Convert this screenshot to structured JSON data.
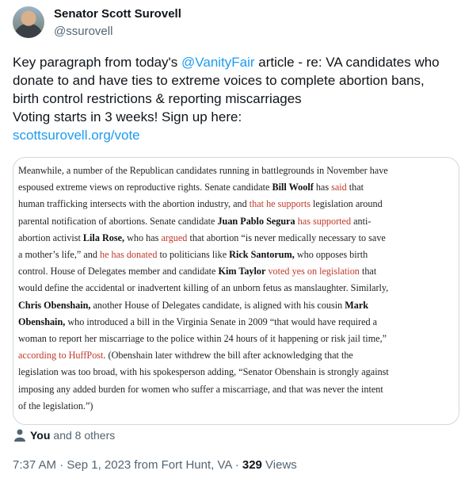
{
  "author": {
    "name": "Senator Scott Surovell",
    "handle": "@ssurovell"
  },
  "tweet": {
    "line1_a": "Key paragraph from today's ",
    "line1_mention": "@VanityFair",
    "line1_b": " article  - re: VA candidates who",
    "line2": "donate to and have ties to extreme voices to complete abortion bans,",
    "line3": "birth control restrictions & reporting miscarriages",
    "line4": "Voting starts in 3 weeks!  Sign up here:",
    "link": "scottsurovell.org/vote"
  },
  "excerpt": {
    "l1": "Meanwhile, a number of the Republican candidates running in battlegrounds in November have",
    "l2": "espoused extreme views on reproductive rights. Senate candidate ",
    "l2_b": "Bill Woolf",
    "l2_c": " has ",
    "l2_r": "said",
    "l2_d": " that",
    "l3_a": "human trafficking intersects with the abortion industry, and ",
    "l3_r": "that he supports",
    "l3_b": " legislation around",
    "l4_a": "parental notification of abortions. Senate candidate ",
    "l4_b": "Juan Pablo Segura",
    "l4_r": " has supported",
    "l4_c": " anti-",
    "l5_a": "abortion activist ",
    "l5_b": "Lila Rose,",
    "l5_c": " who has ",
    "l5_r": "argued",
    "l5_d": " that abortion “is never medically necessary to save",
    "l6_a": "a mother’s life,” and ",
    "l6_r": "he has donated",
    "l6_b": " to politicians like ",
    "l6_c": "Rick Santorum,",
    "l6_d": " who opposes birth",
    "l7_a": "control. House of Delegates member and candidate ",
    "l7_b": "Kim Taylor",
    "l7_r": " voted yes on legislation",
    "l7_c": " that",
    "l8": "would define the accidental or inadvertent killing of an unborn fetus as manslaughter. Similarly,",
    "l9_b": "Chris Obenshain,",
    "l9_a": " another House of Delegates candidate, is aligned with his cousin ",
    "l9_c": "Mark",
    "l10_b": "Obenshain,",
    "l10_a": " who introduced a bill in the Virginia Senate in 2009 “that would have required a",
    "l11": "woman to report her miscarriage to the police within 24 hours of it happening or risk jail time,”",
    "l12_r": "according to HuffPost",
    "l12_a": ". (Obenshain later withdrew the bill after acknowledging that the",
    "l13": "legislation was too broad, with his spokesperson adding, “Senator Obenshain is strongly against",
    "l14": "imposing any added burden for women who suffer a miscarriage, and that was never the intent",
    "l15": "of the legislation.”)"
  },
  "likes": {
    "you": "You",
    "others": "and 8 others"
  },
  "meta": {
    "time": "7:37 AM · Sep 1, 2023 from Fort Hunt, VA · ",
    "views_count": "329",
    "views_label": " Views"
  },
  "colors": {
    "link": "#1d9bf0",
    "excerpt_link": "#c0392b",
    "secondary": "#536471"
  }
}
